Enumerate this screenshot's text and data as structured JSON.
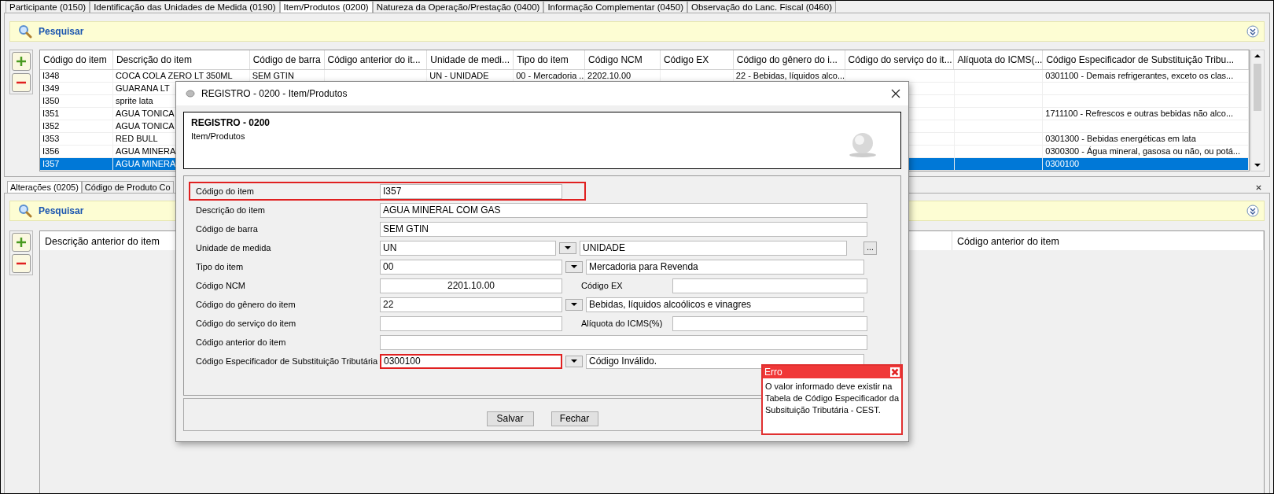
{
  "tabs": [
    {
      "label": "Participante (0150)",
      "selected": false
    },
    {
      "label": "Identificação das Unidades de Medida (0190)",
      "selected": false
    },
    {
      "label": "Item/Produtos (0200)",
      "selected": true
    },
    {
      "label": "Natureza da Operação/Prestação (0400)",
      "selected": false
    },
    {
      "label": "Informação Complementar (0450)",
      "selected": false
    },
    {
      "label": "Observação do Lanc. Fiscal (0460)",
      "selected": false
    }
  ],
  "upper_panel": {
    "search_title": "Pesquisar",
    "table": {
      "columns": [
        "Código do item",
        "Descrição do item",
        "Código de barra",
        "Código anterior do it...",
        "Unidade de medi...",
        "Tipo do item",
        "Código NCM",
        "Código EX",
        "Código do gênero do i...",
        "Código do serviço do it...",
        "Alíquota do ICMS(...",
        "Código Especificador de Substituição Tribu..."
      ],
      "rows": [
        {
          "selected": false,
          "cells": [
            "I348",
            "COCA COLA ZERO LT 350ML",
            "SEM GTIN",
            null,
            "UN - UNIDADE",
            "00 - Mercadoria ...",
            "2202.10.00",
            null,
            "22 - Bebidas, líquidos alco...",
            null,
            null,
            "0301100 - Demais refrigerantes, exceto os clas..."
          ]
        },
        {
          "selected": false,
          "cells": [
            "I349",
            "GUARANA LT",
            null,
            null,
            null,
            null,
            null,
            null,
            null,
            null,
            null,
            null
          ]
        },
        {
          "selected": false,
          "cells": [
            "I350",
            "sprite lata",
            null,
            null,
            null,
            null,
            null,
            null,
            null,
            null,
            null,
            null
          ]
        },
        {
          "selected": false,
          "cells": [
            "I351",
            "AGUA TONICA",
            null,
            null,
            null,
            null,
            null,
            null,
            null,
            null,
            null,
            "1711100 - Refrescos e outras bebidas não alco..."
          ]
        },
        {
          "selected": false,
          "cells": [
            "I352",
            "AGUA TONICA",
            null,
            null,
            null,
            null,
            null,
            null,
            null,
            null,
            null,
            null
          ]
        },
        {
          "selected": false,
          "cells": [
            "I353",
            "RED BULL",
            null,
            null,
            null,
            null,
            null,
            null,
            null,
            null,
            null,
            "0301300 - Bebidas energéticas em lata"
          ]
        },
        {
          "selected": false,
          "cells": [
            "I356",
            "AGUA MINERA",
            null,
            null,
            null,
            null,
            null,
            null,
            null,
            null,
            null,
            "0300300 - Água mineral, gasosa ou não, ou potá..."
          ]
        },
        {
          "selected": true,
          "cells": [
            "I357",
            "AGUA MINERA",
            null,
            null,
            null,
            null,
            null,
            null,
            null,
            null,
            null,
            "0300100"
          ]
        }
      ]
    }
  },
  "lower_panel": {
    "tabs": [
      {
        "label": "Alterações (0205)",
        "selected": true
      },
      {
        "label": "Código de Produto Co",
        "selected": false
      }
    ],
    "search_title": "Pesquisar",
    "table": {
      "columns": [
        "Descrição anterior do item",
        "Código anterior do item"
      ]
    }
  },
  "dialog": {
    "title": "REGISTRO - 0200 - Item/Produtos",
    "header_title": "REGISTRO - 0200",
    "header_subtitle": "Item/Produtos",
    "fields": [
      {
        "kind": "short",
        "label": "Código do item",
        "value": "I357",
        "highlighted": true,
        "invalid": false,
        "centered": false
      },
      {
        "kind": "long",
        "label": "Descrição do item",
        "value": "AGUA MINERAL COM GAS",
        "highlighted": false,
        "invalid": false,
        "centered": false
      },
      {
        "kind": "long",
        "label": "Código de barra",
        "value": "SEM GTIN",
        "highlighted": false,
        "invalid": false,
        "centered": false
      },
      {
        "kind": "combo",
        "label": "Unidade de medida",
        "value": "UN",
        "value2": "UNIDADE",
        "button": "...",
        "highlighted": false,
        "invalid": false,
        "centered": false
      },
      {
        "kind": "combo",
        "label": "Tipo do item",
        "value": "00",
        "value2": "Mercadoria para Revenda",
        "highlighted": false,
        "invalid": false,
        "centered": false
      },
      {
        "kind": "pair",
        "label": "Código NCM",
        "value": "2201.10.00",
        "label2": "Código EX",
        "highlighted": false,
        "invalid": false,
        "centered": true
      },
      {
        "kind": "combo",
        "label": "Código do gênero do item",
        "value": "22",
        "value2": "Bebidas, líquidos alcoólicos e vinagres",
        "highlighted": false,
        "invalid": false,
        "centered": false
      },
      {
        "kind": "pair",
        "label": "Código do serviço do item",
        "label2": "Alíquota do ICMS(%)",
        "highlighted": false,
        "invalid": false
      },
      {
        "kind": "long",
        "label": "Código anterior do item",
        "highlighted": false,
        "invalid": false
      },
      {
        "kind": "combo",
        "label": "Código Especificador de Substituição Tributária",
        "value": "0300100",
        "value2": "Código Inválido.",
        "highlighted": false,
        "invalid": true,
        "centered": false
      }
    ],
    "buttons": [
      "Salvar",
      "Fechar"
    ]
  },
  "error_popup": {
    "title": "Erro",
    "message": "O valor informado deve existir na Tabela de Código Especificador da Subsituição Tributária - CEST."
  }
}
